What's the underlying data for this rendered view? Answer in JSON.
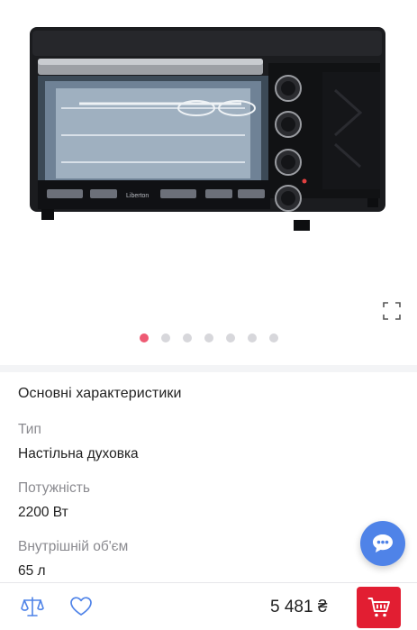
{
  "gallery": {
    "product_image_alt": "Liberton",
    "brand_label": "Liberton",
    "dots_count": 7,
    "active_dot": 0
  },
  "specs": {
    "title": "Основні характеристики",
    "items": [
      {
        "name": "Тип",
        "value": "Настільна духовка"
      },
      {
        "name": "Потужність",
        "value": "2200 Вт"
      },
      {
        "name": "Внутрішній об'єм",
        "value": "65 л"
      }
    ]
  },
  "bottom_bar": {
    "price": "5 481 ₴"
  },
  "colors": {
    "accent_red": "#e21e32",
    "active_dot": "#ee5a73",
    "chat_blue": "#4f83e8"
  },
  "icons": {
    "expand": "expand-icon",
    "chat": "chat-icon",
    "compare": "scales-icon",
    "wishlist": "heart-icon",
    "cart": "cart-icon"
  }
}
